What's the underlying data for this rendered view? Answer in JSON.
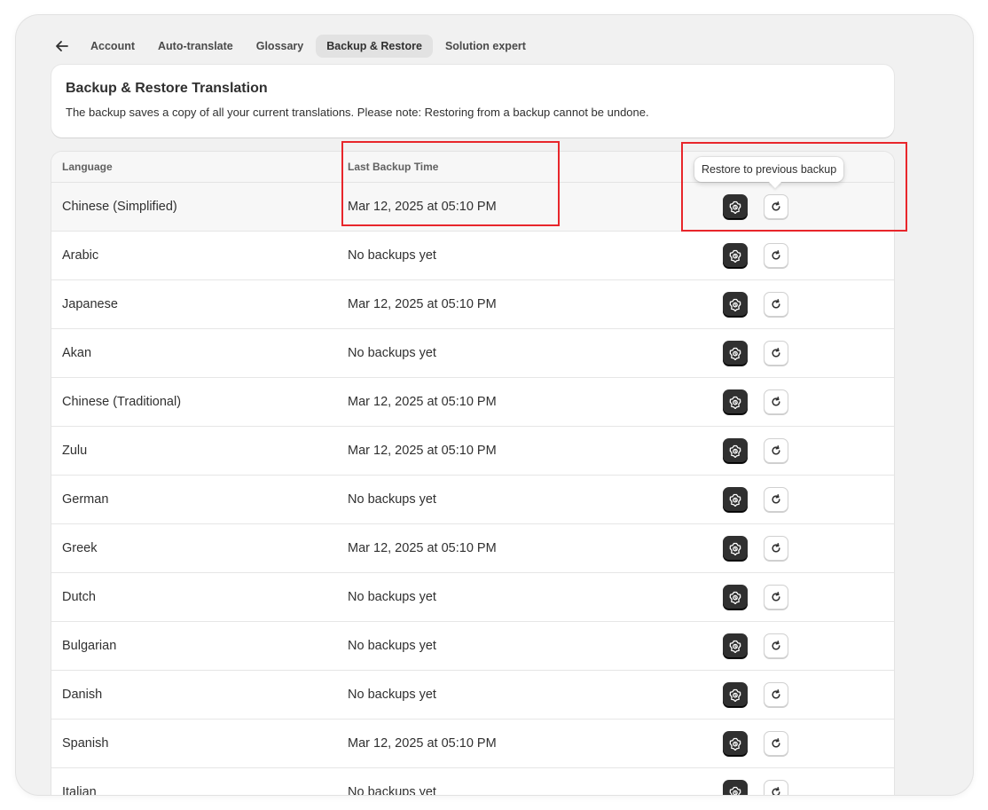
{
  "nav": {
    "tabs": [
      {
        "label": "Account",
        "active": false
      },
      {
        "label": "Auto-translate",
        "active": false
      },
      {
        "label": "Glossary",
        "active": false
      },
      {
        "label": "Backup & Restore",
        "active": true
      },
      {
        "label": "Solution expert",
        "active": false
      }
    ]
  },
  "card": {
    "title": "Backup & Restore Translation",
    "description": "The backup saves a copy of all your current translations. Please note: Restoring from a backup cannot be undone."
  },
  "table": {
    "headers": {
      "language": "Language",
      "last_backup": "Last Backup Time"
    },
    "rows": [
      {
        "language": "Chinese (Simplified)",
        "time": "Mar 12, 2025 at 05:10 PM"
      },
      {
        "language": "Arabic",
        "time": "No backups yet"
      },
      {
        "language": "Japanese",
        "time": "Mar 12, 2025 at 05:10 PM"
      },
      {
        "language": "Akan",
        "time": "No backups yet"
      },
      {
        "language": "Chinese (Traditional)",
        "time": "Mar 12, 2025 at 05:10 PM"
      },
      {
        "language": "Zulu",
        "time": "Mar 12, 2025 at 05:10 PM"
      },
      {
        "language": "German",
        "time": "No backups yet"
      },
      {
        "language": "Greek",
        "time": "Mar 12, 2025 at 05:10 PM"
      },
      {
        "language": "Dutch",
        "time": "No backups yet"
      },
      {
        "language": "Bulgarian",
        "time": "No backups yet"
      },
      {
        "language": "Danish",
        "time": "No backups yet"
      },
      {
        "language": "Spanish",
        "time": "Mar 12, 2025 at 05:10 PM"
      },
      {
        "language": "Italian",
        "time": "No backups yet"
      }
    ]
  },
  "tooltip": {
    "text": "Restore to previous backup"
  },
  "icons": {
    "back": "arrow-left-icon",
    "backup": "backup-icon",
    "restore": "restore-icon"
  },
  "colors": {
    "highlight": "#e8262b",
    "dark_button": "#303030",
    "active_tab": "#e2e2e2"
  }
}
